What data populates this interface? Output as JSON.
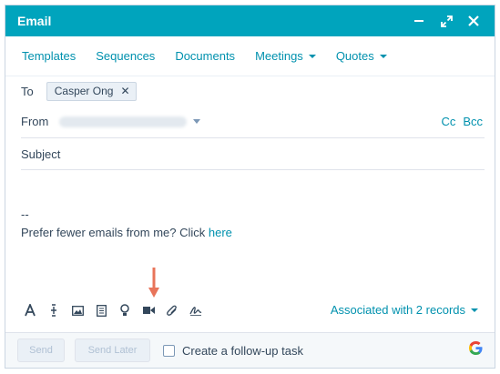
{
  "header": {
    "title": "Email"
  },
  "tabs": [
    {
      "label": "Templates",
      "dropdown": false
    },
    {
      "label": "Sequences",
      "dropdown": false
    },
    {
      "label": "Documents",
      "dropdown": false
    },
    {
      "label": "Meetings",
      "dropdown": true
    },
    {
      "label": "Quotes",
      "dropdown": true
    }
  ],
  "fields": {
    "to_label": "To",
    "recipient": "Casper Ong",
    "from_label": "From",
    "cc_label": "Cc",
    "bcc_label": "Bcc",
    "subject_label": "Subject"
  },
  "body": {
    "signature_sep": "--",
    "unsubscribe_text": "Prefer fewer emails from me? Click ",
    "unsubscribe_link": "here"
  },
  "toolbar": {
    "icons": [
      "text-format-icon",
      "personalize-icon",
      "image-icon",
      "snippets-icon",
      "knowledge-icon",
      "video-icon",
      "attachment-icon",
      "signature-icon"
    ],
    "associated_label": "Associated with 2 records"
  },
  "footer": {
    "send_label": "Send",
    "send_later_label": "Send Later",
    "followup_label": "Create a follow-up task"
  },
  "colors": {
    "header_bg": "#00a4bd",
    "link": "#0091ae",
    "arrow": "#e8745a"
  }
}
